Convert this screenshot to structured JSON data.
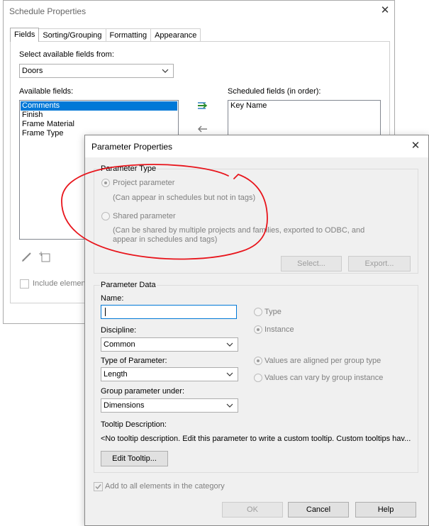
{
  "schedule_dialog": {
    "title": "Schedule Properties",
    "tabs": [
      "Fields",
      "Sorting/Grouping",
      "Formatting",
      "Appearance"
    ],
    "active_tab": "Fields",
    "select_fields_label": "Select available fields from:",
    "category_value": "Doors",
    "available_fields_label": "Available fields:",
    "available_fields": [
      "Comments",
      "Finish",
      "Frame Material",
      "Frame Type"
    ],
    "selected_available_field": "Comments",
    "scheduled_fields_label": "Scheduled fields (in order):",
    "scheduled_fields": [
      "Key Name"
    ],
    "include_elements_label": "Include elements",
    "icons": [
      "add-parameter-icon",
      "remove-parameter-icon",
      "edit-field-icon",
      "new-field-icon"
    ],
    "selection_color": "#0078d7"
  },
  "parameter_dialog": {
    "title": "Parameter Properties",
    "parameter_type": {
      "group_label": "Parameter Type",
      "project_label": "Project parameter",
      "project_desc": "(Can appear in schedules but not in tags)",
      "shared_label": "Shared parameter",
      "shared_desc_1": "(Can be shared by multiple projects and families, exported to ODBC, and",
      "shared_desc_2": "appear in schedules and tags)",
      "selected": "Project parameter",
      "select_button": "Select...",
      "export_button": "Export..."
    },
    "parameter_data": {
      "group_label": "Parameter Data",
      "name_label": "Name:",
      "name_value": "",
      "discipline_label": "Discipline:",
      "discipline_value": "Common",
      "type_label": "Type of Parameter:",
      "type_value": "Length",
      "group_under_label": "Group parameter under:",
      "group_under_value": "Dimensions",
      "type_radio": "Type",
      "instance_radio": "Instance",
      "binding_selected": "Instance",
      "aligned_radio": "Values are aligned per group type",
      "vary_radio": "Values can vary by group instance",
      "variance_selected": "Values are aligned per group type",
      "tooltip_label": "Tooltip Description:",
      "tooltip_text": "<No tooltip description. Edit this parameter to write a custom tooltip. Custom tooltips hav...",
      "edit_tooltip_button": "Edit Tooltip..."
    },
    "add_to_all_label": "Add to all elements in the category",
    "add_to_all_checked": true,
    "ok_button": "OK",
    "cancel_button": "Cancel",
    "help_button": "Help"
  },
  "annotation": {
    "color": "#e8141b",
    "shape": "freehand-ellipse"
  }
}
